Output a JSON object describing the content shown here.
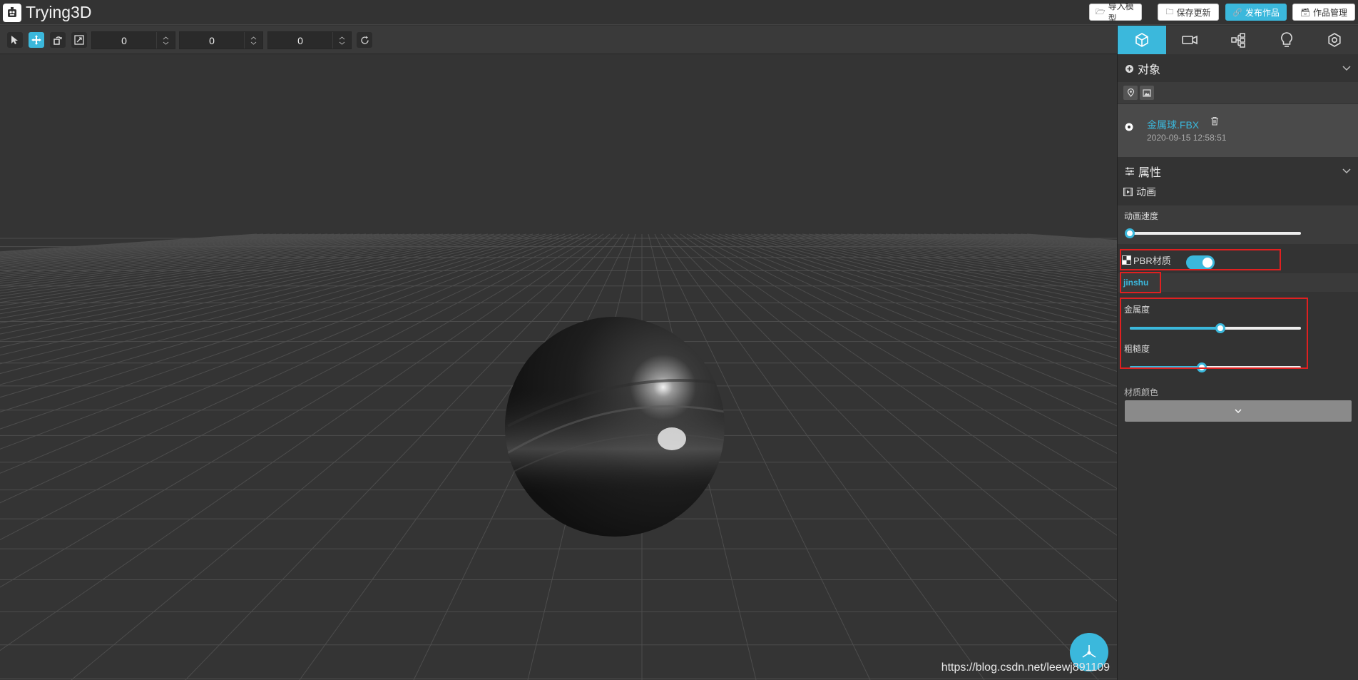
{
  "app": {
    "title": "Trying3D"
  },
  "header": {
    "buttons": [
      {
        "label": "导入模型",
        "icon": "folder-open-icon"
      },
      {
        "label": "保存更新",
        "icon": "folder-icon"
      },
      {
        "label": "发布作品",
        "icon": "link-icon"
      },
      {
        "label": "作品管理",
        "icon": "archive-icon"
      }
    ]
  },
  "toolbar": {
    "tools": [
      "select-tool",
      "move-tool",
      "rotate-tool",
      "scale-tool"
    ],
    "active_tool": "move-tool",
    "inputs": [
      {
        "value": "0"
      },
      {
        "value": "0"
      },
      {
        "value": "0"
      }
    ]
  },
  "panel": {
    "tabs": [
      {
        "icon": "cube-icon",
        "active": true
      },
      {
        "icon": "camera-icon",
        "active": false
      },
      {
        "icon": "hierarchy-icon",
        "active": false
      },
      {
        "icon": "lightbulb-icon",
        "active": false
      },
      {
        "icon": "settings-icon",
        "active": false
      }
    ],
    "objects": {
      "title": "对象",
      "item": {
        "name": "金属球.FBX",
        "timestamp": "2020-09-15 12:58:51"
      }
    },
    "properties": {
      "title": "属性",
      "animation": {
        "label": "动画",
        "speed_label": "动画速度",
        "speed_value": 0
      },
      "pbr": {
        "label": "PBR材质",
        "enabled": true,
        "material_name": "jinshu"
      },
      "metalness": {
        "label": "金属度",
        "value": 0.53
      },
      "roughness": {
        "label": "粗糙度",
        "value": 0.42
      },
      "color": {
        "label": "材质颜色"
      }
    }
  },
  "viewport": {
    "watermark": "https://blog.csdn.net/leewj891109"
  },
  "colors": {
    "accent": "#3bb8dc",
    "highlight": "#e02020"
  }
}
